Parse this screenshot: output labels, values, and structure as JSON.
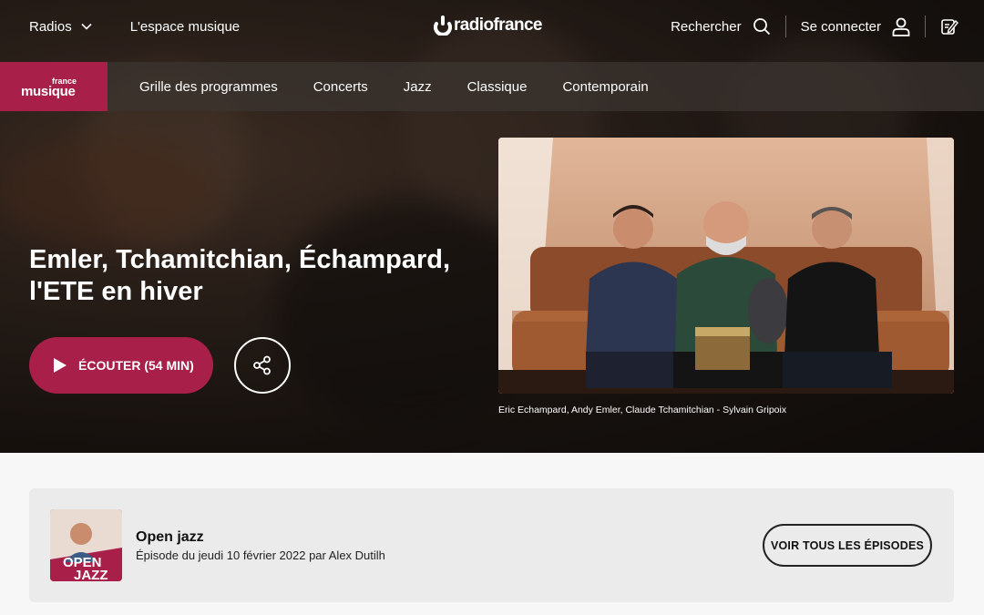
{
  "topnav": {
    "radios_label": "Radios",
    "music_space_label": "L'espace musique",
    "brand": "radiofrance",
    "search_label": "Rechercher",
    "login_label": "Se connecter"
  },
  "station": {
    "line1": "france",
    "line2": "musique",
    "color": "#a81f4a"
  },
  "subnav": {
    "items": [
      "Grille des programmes",
      "Concerts",
      "Jazz",
      "Classique",
      "Contemporain"
    ]
  },
  "hero": {
    "title": "Emler, Tchamitchian, Échampard, l'ETE en hiver",
    "listen_label": "ÉCOUTER (54 MIN)",
    "caption": "Eric Echampard, Andy Emler, Claude Tchamitchian - Sylvain Gripoix"
  },
  "episode": {
    "show_name": "Open jazz",
    "info": "Épisode du jeudi 10 février 2022 par Alex Dutilh",
    "all_episodes_label": "VOIR TOUS LES ÉPISODES",
    "thumb_text_1": "OPEN",
    "thumb_text_2": "JAZZ"
  }
}
